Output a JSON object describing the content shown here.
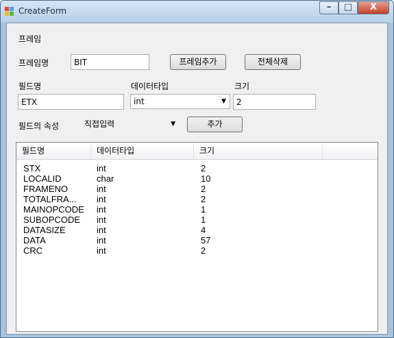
{
  "window": {
    "title": "CreateForm",
    "minimize_label": "–",
    "maximize_label": "□",
    "close_label": "X"
  },
  "frame_group": {
    "label": "프레임"
  },
  "frame_name": {
    "label": "프레임명",
    "value": "BIT"
  },
  "buttons": {
    "add_frame": "프레임추가",
    "delete_all": "전체삭제",
    "add": "추가"
  },
  "field_name": {
    "label": "필드명",
    "value": "ETX"
  },
  "data_type": {
    "label": "데이터타입",
    "value": "int"
  },
  "size": {
    "label": "크기",
    "value": "2"
  },
  "field_attr": {
    "label": "필드의 속성",
    "value": "직접입력"
  },
  "table": {
    "columns": [
      "필드명",
      "데이터타입",
      "크기"
    ],
    "rows": [
      [
        "STX",
        "int",
        "2"
      ],
      [
        "LOCALID",
        "char",
        "10"
      ],
      [
        "FRAMENO",
        "int",
        "2"
      ],
      [
        "TOTALFRA...",
        "int",
        "2"
      ],
      [
        "MAINOPCODE",
        "int",
        "1"
      ],
      [
        "SUBOPCODE",
        "int",
        "1"
      ],
      [
        "DATASIZE",
        "int",
        "4"
      ],
      [
        "DATA",
        "int",
        "57"
      ],
      [
        "CRC",
        "int",
        "2"
      ]
    ]
  },
  "colors": {
    "titlebar": "#c9dcf0",
    "client": "#f0f0f0",
    "close_button": "#c9462f"
  },
  "icons": [
    "app-form-icon",
    "minimize-icon",
    "maximize-icon",
    "close-icon",
    "dropdown-arrow-icon"
  ]
}
